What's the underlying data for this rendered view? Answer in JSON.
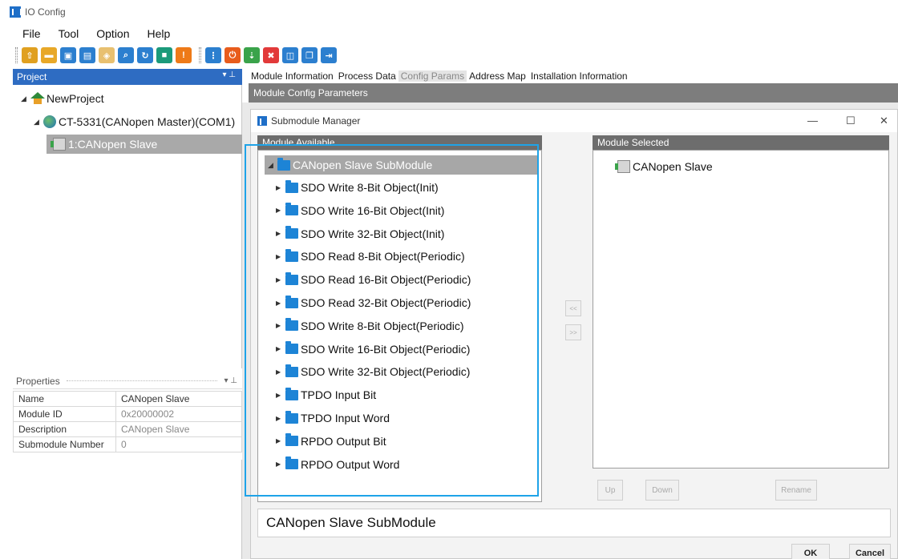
{
  "window": {
    "title": "IO Config"
  },
  "menu": [
    "File",
    "Tool",
    "Option",
    "Help"
  ],
  "toolbar": {
    "groups": [
      [
        {
          "icon": "open-folder-icon",
          "color": "#e0a020"
        },
        {
          "icon": "folder-icon",
          "color": "#e8a828"
        },
        {
          "icon": "save-icon",
          "color": "#2c7fcf"
        },
        {
          "icon": "save-all-icon",
          "color": "#2c7fcf"
        },
        {
          "icon": "package-icon",
          "color": "#e8c070"
        },
        {
          "icon": "search-icon",
          "color": "#2c7fcf"
        },
        {
          "icon": "refresh-icon",
          "color": "#2c7fcf"
        },
        {
          "icon": "stop-icon",
          "color": "#1b9a7a"
        },
        {
          "icon": "warning-icon",
          "color": "#ee7a18"
        }
      ],
      [
        {
          "icon": "tree-icon",
          "color": "#2c7fcf"
        },
        {
          "icon": "power-icon",
          "color": "#e85c1c"
        },
        {
          "icon": "download-icon",
          "color": "#3aa34a"
        },
        {
          "icon": "delete-icon",
          "color": "#e23a3a"
        },
        {
          "icon": "frame-icon",
          "color": "#2c7fcf"
        },
        {
          "icon": "copy-icon",
          "color": "#2c7fcf"
        },
        {
          "icon": "export-icon",
          "color": "#2c7fcf"
        }
      ]
    ]
  },
  "project": {
    "header": "Project",
    "root": "NewProject",
    "master": "CT-5331(CANopen Master)(COM1)",
    "slave": "1:CANopen Slave"
  },
  "properties": {
    "header": "Properties",
    "rows": [
      {
        "key": "Name",
        "value": "CANopen Slave"
      },
      {
        "key": "Module ID",
        "value": "0x20000002"
      },
      {
        "key": "Description",
        "value": "CANopen Slave"
      },
      {
        "key": "Submodule Number",
        "value": "0"
      }
    ]
  },
  "tabs": [
    "Module Information",
    "Process Data",
    "Config Params",
    "Address Map",
    "Installation Information"
  ],
  "active_tab": "Config Params",
  "config_header": "Module Config Parameters",
  "dialog": {
    "title": "Submodule Manager",
    "available_header": "Module Available",
    "root": "CANopen Slave SubModule",
    "items": [
      "SDO Write 8-Bit Object(Init)",
      "SDO Write 16-Bit Object(Init)",
      "SDO Write 32-Bit Object(Init)",
      "SDO Read 8-Bit Object(Periodic)",
      "SDO Read 16-Bit Object(Periodic)",
      "SDO Read 32-Bit Object(Periodic)",
      "SDO Write 8-Bit Object(Periodic)",
      "SDO Write 16-Bit Object(Periodic)",
      "SDO Write 32-Bit Object(Periodic)",
      "TPDO Input Bit",
      "TPDO Input Word",
      "RPDO Output Bit",
      "RPDO Output Word"
    ],
    "selected_header": "Module Selected",
    "selected_items": [
      "CANopen Slave"
    ],
    "add_button": "<<",
    "remove_button": ">>",
    "up_button": "Up",
    "down_button": "Down",
    "rename_button": "Rename",
    "description": "CANopen Slave SubModule",
    "ok": "OK",
    "cancel": "Cancel"
  }
}
